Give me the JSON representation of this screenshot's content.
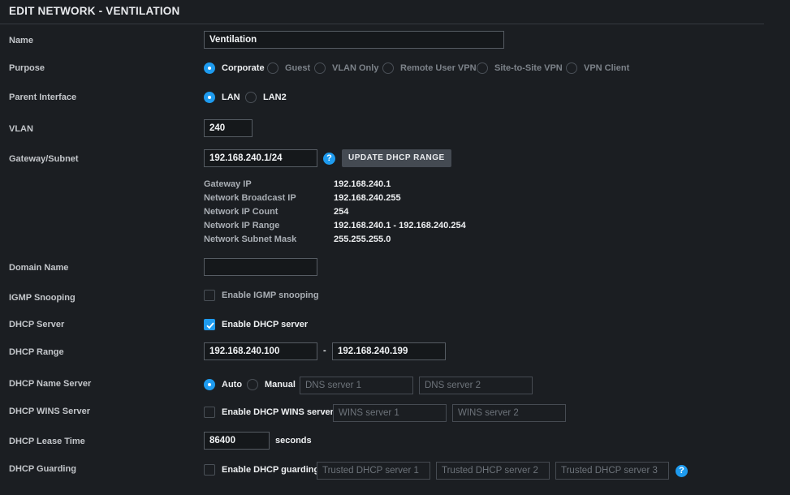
{
  "header": {
    "title": "EDIT NETWORK - VENTILATION"
  },
  "fields": {
    "name": {
      "label": "Name",
      "value": "Ventilation"
    },
    "purpose": {
      "label": "Purpose",
      "options": [
        "Corporate",
        "Guest",
        "VLAN Only",
        "Remote User VPN",
        "Site-to-Site VPN",
        "VPN Client"
      ],
      "selected": "Corporate"
    },
    "parent_interface": {
      "label": "Parent Interface",
      "options": [
        "LAN",
        "LAN2"
      ],
      "selected": "LAN"
    },
    "vlan": {
      "label": "VLAN",
      "value": "240"
    },
    "gateway_subnet": {
      "label": "Gateway/Subnet",
      "value": "192.168.240.1/24",
      "help": "?",
      "button": "UPDATE DHCP RANGE"
    },
    "network_info": [
      {
        "label": "Gateway IP",
        "value": "192.168.240.1"
      },
      {
        "label": "Network Broadcast IP",
        "value": "192.168.240.255"
      },
      {
        "label": "Network IP Count",
        "value": "254"
      },
      {
        "label": "Network IP Range",
        "value": "192.168.240.1 - 192.168.240.254"
      },
      {
        "label": "Network Subnet Mask",
        "value": "255.255.255.0"
      }
    ],
    "domain_name": {
      "label": "Domain Name",
      "value": ""
    },
    "igmp_snooping": {
      "label": "IGMP Snooping",
      "checkbox_label": "Enable IGMP snooping",
      "checked": false
    },
    "dhcp_server": {
      "label": "DHCP Server",
      "checkbox_label": "Enable DHCP server",
      "checked": true
    },
    "dhcp_range": {
      "label": "DHCP Range",
      "start": "192.168.240.100",
      "separator": "-",
      "end": "192.168.240.199"
    },
    "dhcp_name_server": {
      "label": "DHCP Name Server",
      "options": [
        "Auto",
        "Manual"
      ],
      "selected": "Auto",
      "dns1_placeholder": "DNS server 1",
      "dns2_placeholder": "DNS server 2"
    },
    "dhcp_wins_server": {
      "label": "DHCP WINS Server",
      "checkbox_label": "Enable DHCP WINS server",
      "checked": false,
      "wins1_placeholder": "WINS server 1",
      "wins2_placeholder": "WINS server 2"
    },
    "dhcp_lease_time": {
      "label": "DHCP Lease Time",
      "value": "86400",
      "unit": "seconds"
    },
    "dhcp_guarding": {
      "label": "DHCP Guarding",
      "checkbox_label": "Enable DHCP guarding",
      "checked": false,
      "trusted1_placeholder": "Trusted DHCP server 1",
      "trusted2_placeholder": "Trusted DHCP server 2",
      "trusted3_placeholder": "Trusted DHCP server 3",
      "help": "?"
    }
  },
  "colors": {
    "accent": "#1e9bef",
    "background": "#1b1e22",
    "button": "#444a52"
  }
}
